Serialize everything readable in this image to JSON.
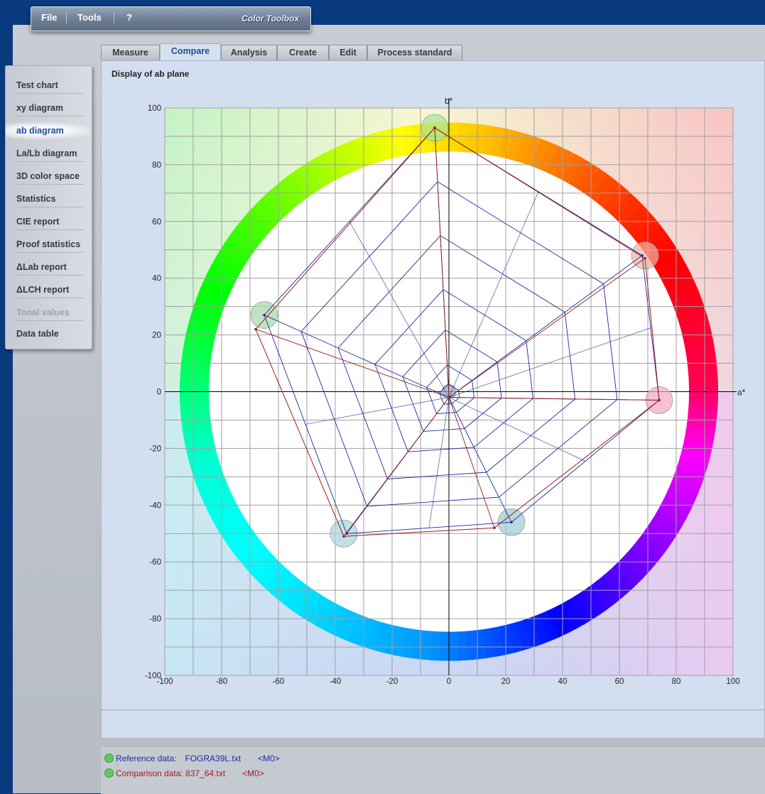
{
  "menubar": {
    "items": [
      "File",
      "Tools",
      "?"
    ],
    "brand": "Color Toolbox"
  },
  "tabs": [
    {
      "label": "Measure",
      "active": false
    },
    {
      "label": "Compare",
      "active": true
    },
    {
      "label": "Analysis",
      "active": false
    },
    {
      "label": "Create",
      "active": false
    },
    {
      "label": "Edit",
      "active": false
    },
    {
      "label": "Process standard",
      "active": false
    }
  ],
  "sidebar": {
    "items": [
      {
        "label": "Test chart",
        "state": "normal"
      },
      {
        "label": "xy diagram",
        "state": "normal"
      },
      {
        "label": "ab diagram",
        "state": "active"
      },
      {
        "label": "La/Lb diagram",
        "state": "normal"
      },
      {
        "label": "3D color space",
        "state": "normal"
      },
      {
        "label": "Statistics",
        "state": "normal"
      },
      {
        "label": "CIE report",
        "state": "normal"
      },
      {
        "label": "Proof statistics",
        "state": "normal"
      },
      {
        "label": "ΔLab report",
        "state": "normal"
      },
      {
        "label": "ΔLCH report",
        "state": "normal"
      },
      {
        "label": "Tonal values",
        "state": "disabled"
      },
      {
        "label": "Data table",
        "state": "normal"
      }
    ]
  },
  "panel": {
    "title": "Display of ab plane"
  },
  "status": {
    "reference_label": "Reference data:",
    "reference_file": "FOGRA39L.txt",
    "reference_tag": "<M0>",
    "comparison_label": "Comparison data: 837_64.txt",
    "comparison_tag": "<M0>"
  },
  "colors": {
    "reference": "#1e2a9e",
    "comparison": "#9b1c1c",
    "accent": "#1c4f9c"
  },
  "chart_data": {
    "type": "scatter",
    "title": "",
    "xlabel": "a*",
    "ylabel": "b*",
    "xlim": [
      -100,
      100
    ],
    "ylim": [
      -100,
      100
    ],
    "xticks": [
      -100,
      -80,
      -60,
      -40,
      -20,
      0,
      20,
      40,
      60,
      80,
      100
    ],
    "yticks": [
      -100,
      -80,
      -60,
      -40,
      -20,
      0,
      20,
      40,
      60,
      80,
      100
    ],
    "grid": true,
    "hue_ring": true,
    "series": [
      {
        "name": "Reference data",
        "color": "#1e2a9e",
        "primaries": [
          {
            "a": -5,
            "b": 93
          },
          {
            "a": 68,
            "b": 48
          },
          {
            "a": 74,
            "b": -3
          },
          {
            "a": 22,
            "b": -46
          },
          {
            "a": -36,
            "b": -50
          },
          {
            "a": -65,
            "b": 27
          }
        ],
        "paper_white": {
          "a": 0,
          "b": -2
        }
      },
      {
        "name": "Comparison data",
        "color": "#9b1c1c",
        "primaries": [
          {
            "a": -5,
            "b": 93
          },
          {
            "a": 69,
            "b": 47
          },
          {
            "a": 74,
            "b": -3
          },
          {
            "a": 16,
            "b": -48
          },
          {
            "a": -37,
            "b": -51
          },
          {
            "a": -68,
            "b": 22
          }
        ],
        "paper_white": {
          "a": 0,
          "b": -2
        }
      }
    ],
    "target_markers": [
      {
        "a": -5,
        "b": 93,
        "color": "#a6e29a"
      },
      {
        "a": 69,
        "b": 48,
        "color": "#f1b4a0"
      },
      {
        "a": 74,
        "b": -3,
        "color": "#f2a6c4"
      },
      {
        "a": 22,
        "b": -46,
        "color": "#9cc7ce"
      },
      {
        "a": -37,
        "b": -50,
        "color": "#a8d4d8"
      },
      {
        "a": -65,
        "b": 27,
        "color": "#a6d4a8"
      },
      {
        "a": 0,
        "b": 0,
        "color": "#9aaab8"
      }
    ]
  }
}
